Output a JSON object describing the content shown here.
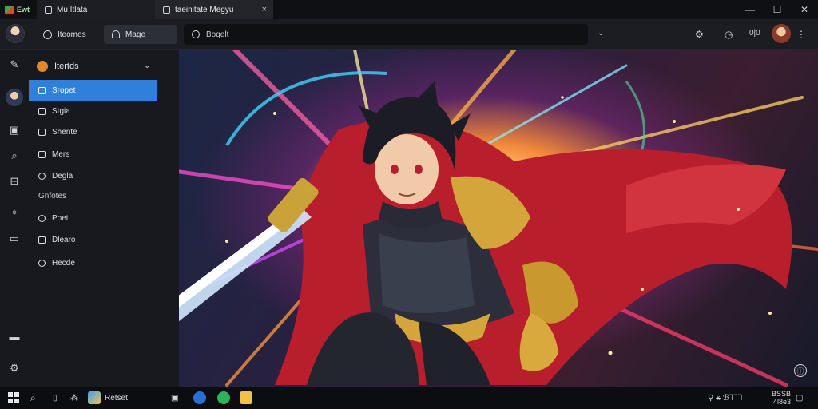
{
  "titlebar": {
    "app_badge": "Ewt",
    "tabs": [
      {
        "label": "Mu Itlata",
        "close": "×"
      },
      {
        "label": "taeinitate  Megyu",
        "close": "×"
      }
    ],
    "window_controls": {
      "minimize": "—",
      "maximize": "☐",
      "close": "✕"
    }
  },
  "toolbar": {
    "buttons": [
      {
        "label": "Iteomes",
        "icon": "compass-icon"
      },
      {
        "label": "Mage",
        "icon": "bell-icon"
      }
    ],
    "search": {
      "value": "Boqelt"
    },
    "dropdown": "⌄",
    "right_icons": [
      "gear-icon",
      "clock-icon",
      "grid-icon"
    ],
    "right_text": "0|0",
    "menu": "⋮"
  },
  "sidebar": {
    "header": "Itertds",
    "chevron": "⌄",
    "items": [
      {
        "label": "Sropet",
        "active": true
      },
      {
        "label": "Stgia",
        "active": false
      },
      {
        "label": "Shente",
        "active": false
      },
      {
        "label": "Mers",
        "active": false
      },
      {
        "label": "Degla",
        "active": false
      }
    ],
    "section": "Gnfotes",
    "items2": [
      {
        "label": "Poet"
      },
      {
        "label": "Dlearo"
      },
      {
        "label": "Hecde"
      }
    ]
  },
  "hero": {
    "corner_icon": "ⓘ"
  },
  "taskbar": {
    "app_label": "Retset",
    "tray_top": "BSSB",
    "tray_bottom": "4l8e3",
    "tray_icons": "⚲  ⚹  ℬꞀꞀꞀ"
  },
  "colors": {
    "accent": "#2f7fdb",
    "bg": "#16181d",
    "brand_orange": "#e2872a"
  }
}
